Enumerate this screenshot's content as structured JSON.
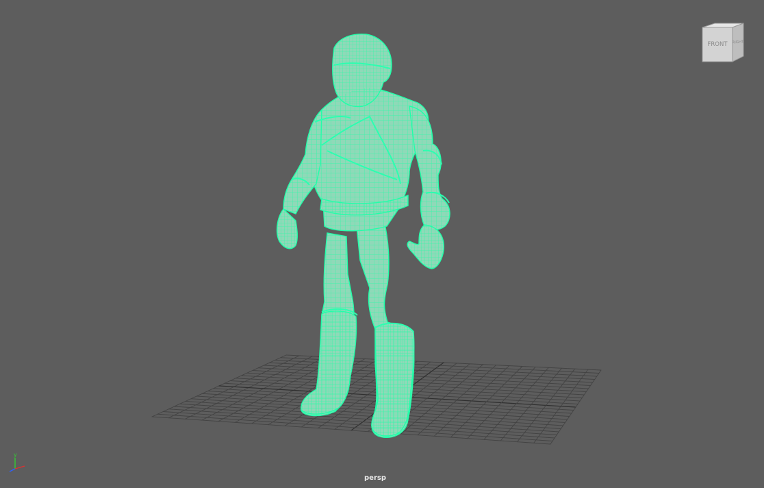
{
  "viewport": {
    "camera_name": "persp",
    "background_color": "#5d5d5d",
    "grid_color": "#434343",
    "grid_axis_color": "#2f2f2f",
    "model_fill_color": "#8fd9b8",
    "model_wire_color": "#1fffa5"
  },
  "viewcube": {
    "front_label": "FRONT",
    "right_label": "RIGHT",
    "face_color": "#d3d3d3",
    "side_color": "#bebebe",
    "top_color": "#e6e6e6"
  },
  "axis_gizmo": {
    "y_label": "y",
    "x_color": "#e03030",
    "y_color": "#33cc33",
    "z_color": "#3060ff"
  }
}
